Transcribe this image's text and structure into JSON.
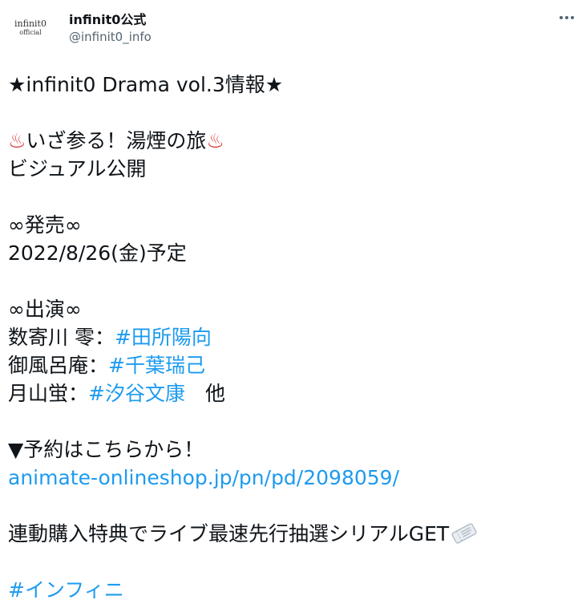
{
  "account": {
    "display_name": "infinit0公式",
    "handle": "@infinit0_info",
    "avatar_logo_main": "infinit0",
    "avatar_logo_sub": "official"
  },
  "tweet": {
    "title": "★infinit0 Drama vol.3情報★",
    "steam_left": "♨",
    "subtitle": "いざ参る！湯煙の旅",
    "steam_right": "♨",
    "visual": "ビジュアル公開",
    "release_heading": "∞発売∞",
    "release_date": "2022/8/26(金)予定",
    "cast_heading": "∞出演∞",
    "cast": [
      {
        "role": "数寄川 零：",
        "actor": "#田所陽向",
        "suffix": ""
      },
      {
        "role": "御風呂庵：",
        "actor": "#千葉瑞己",
        "suffix": ""
      },
      {
        "role": "月山蛍：",
        "actor": "#汐谷文康",
        "suffix": "　他"
      }
    ],
    "preorder": "▼予約はこちらから！",
    "link": "animate-onlineshop.jp/pn/pd/2098059/",
    "bonus": "連動購入特典でライブ最速先行抽選シリアルGET",
    "hashtag_bottom": "#インフィニ"
  },
  "icons": {
    "more": "more-horizontal-icon",
    "steam": "hot-springs-icon",
    "ticket": "ticket-icon"
  },
  "colors": {
    "link": "#1d9bf0",
    "text": "#0f1419",
    "secondary": "#536471"
  }
}
